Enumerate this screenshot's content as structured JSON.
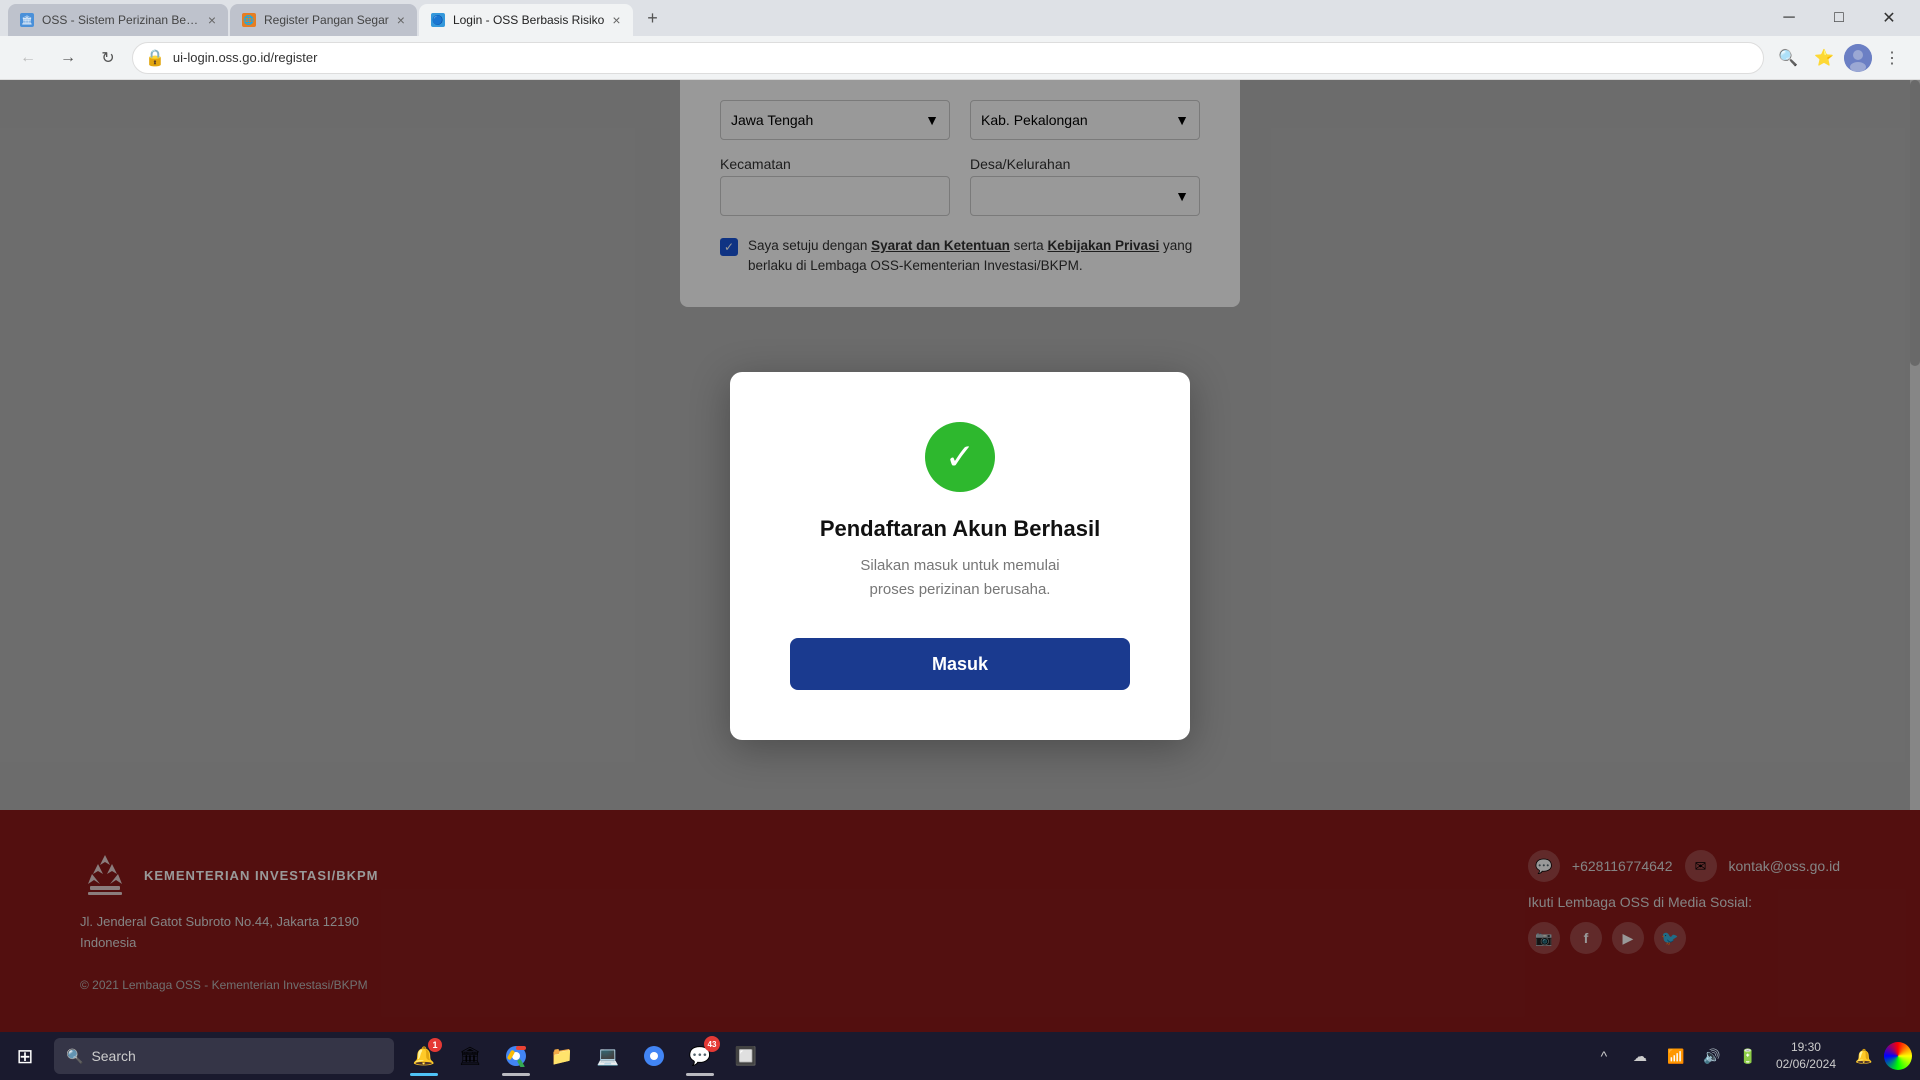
{
  "browser": {
    "tabs": [
      {
        "id": "tab1",
        "favicon_color": "#4a90d9",
        "title": "OSS - Sistem Perizinan Berus...",
        "active": false
      },
      {
        "id": "tab2",
        "favicon_color": "#e67e22",
        "title": "Register Pangan Segar",
        "active": false
      },
      {
        "id": "tab3",
        "favicon_color": "#3498db",
        "title": "Login - OSS Berbasis Risiko",
        "active": true
      }
    ],
    "url": "ui-login.oss.go.id/register",
    "new_tab_label": "+",
    "back_btn": "←",
    "forward_btn": "→",
    "reload_btn": "↻",
    "address_icon": "🔒"
  },
  "form": {
    "province_label": "Jawa Tengah",
    "city_label": "Kab. Pekalongan",
    "kecamatan_label": "Kecamatan",
    "desa_label": "Desa/Kelurahan",
    "checkbox_text_pre": "Saya setuju dengan ",
    "terms_link": "Syarat dan Ketentuan",
    "and_text": " serta ",
    "privacy_link": "Kebijakan Privasi",
    "checkbox_text_post": " yang berlaku di Lembaga OSS-Kementerian Investasi/BKPM."
  },
  "modal": {
    "title": "Pendaftaran Akun Berhasil",
    "subtitle_line1": "Silakan masuk untuk memulai",
    "subtitle_line2": "proses perizinan berusaha.",
    "button_label": "Masuk",
    "checkmark": "✓"
  },
  "footer": {
    "logo_text": "KEMENTERIAN INVESTASI/BKPM",
    "address_line1": "Jl. Jenderal Gatot Subroto No.44, Jakarta 12190",
    "address_line2": "Indonesia",
    "copyright": "© 2021 Lembaga OSS - Kementerian Investasi/BKPM",
    "phone": "+628116774642",
    "email": "kontak@oss.go.id",
    "social_label": "Ikuti Lembaga OSS di Media Sosial:",
    "social_icons": [
      "📷",
      "f",
      "▶",
      "🐦"
    ]
  },
  "taskbar": {
    "start_icon": "⊞",
    "search_placeholder": "Search",
    "search_icon": "🔍",
    "time": "19:30",
    "date": "02/06/2024",
    "apps": [
      {
        "icon": "📋",
        "active": false,
        "badge": null
      },
      {
        "icon": "🌐",
        "active": true,
        "badge": null
      },
      {
        "icon": "📁",
        "active": false,
        "badge": null
      },
      {
        "icon": "💻",
        "active": false,
        "badge": null
      },
      {
        "icon": "🔷",
        "active": false,
        "badge": null
      },
      {
        "icon": "🔴",
        "active": true,
        "badge": null
      },
      {
        "icon": "💬",
        "active": true,
        "badge": "43"
      },
      {
        "icon": "🔲",
        "active": false,
        "badge": null
      }
    ],
    "system_icons": [
      "^",
      "☁",
      "🔔",
      "📶",
      "🔊",
      "🔋"
    ],
    "notification_count": "1"
  }
}
